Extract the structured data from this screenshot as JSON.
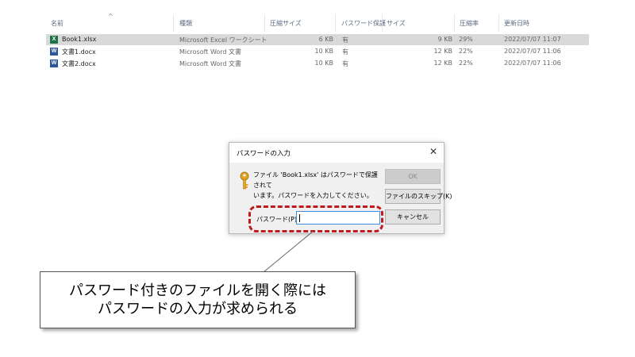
{
  "columns": {
    "name": "名前",
    "type": "種類",
    "compressed_size": "圧縮サイズ",
    "password_protected": "パスワード保護",
    "size": "サイズ",
    "ratio": "圧縮率",
    "modified": "更新日時"
  },
  "files": [
    {
      "icon": "excel-file-icon",
      "name": "Book1.xlsx",
      "type": "Microsoft Excel ワークシート",
      "compressed_size": "6 KB",
      "password_protected": "有",
      "size": "9 KB",
      "ratio": "29%",
      "modified": "2022/07/07 11:07",
      "selected": true
    },
    {
      "icon": "word-file-icon",
      "name": "文書1.docx",
      "type": "Microsoft Word 文書",
      "compressed_size": "10 KB",
      "password_protected": "有",
      "size": "12 KB",
      "ratio": "22%",
      "modified": "2022/07/07 11:06",
      "selected": false
    },
    {
      "icon": "word-file-icon",
      "name": "文書2.docx",
      "type": "Microsoft Word 文書",
      "compressed_size": "10 KB",
      "password_protected": "有",
      "size": "12 KB",
      "ratio": "22%",
      "modified": "2022/07/07 11:06",
      "selected": false
    }
  ],
  "dialog": {
    "title": "パスワードの入力",
    "close_icon": "close-icon",
    "key_icon": "key-icon",
    "message_line1": "ファイル 'Book1.xlsx' はパスワードで保護されて",
    "message_line2": "います。パスワードを入力してください。",
    "ok_label": "OK",
    "skip_label": "ファイルのスキップ(K)",
    "cancel_label": "キャンセル",
    "password_label": "パスワード(P):",
    "password_value": ""
  },
  "callout": {
    "line1": "パスワード付きのファイルを開く際には",
    "line2": "パスワードの入力が求められる"
  },
  "colors": {
    "highlight": "#c0181f",
    "selection": "#d9d9d9",
    "excel": "#1e7145",
    "word": "#2b579a"
  }
}
